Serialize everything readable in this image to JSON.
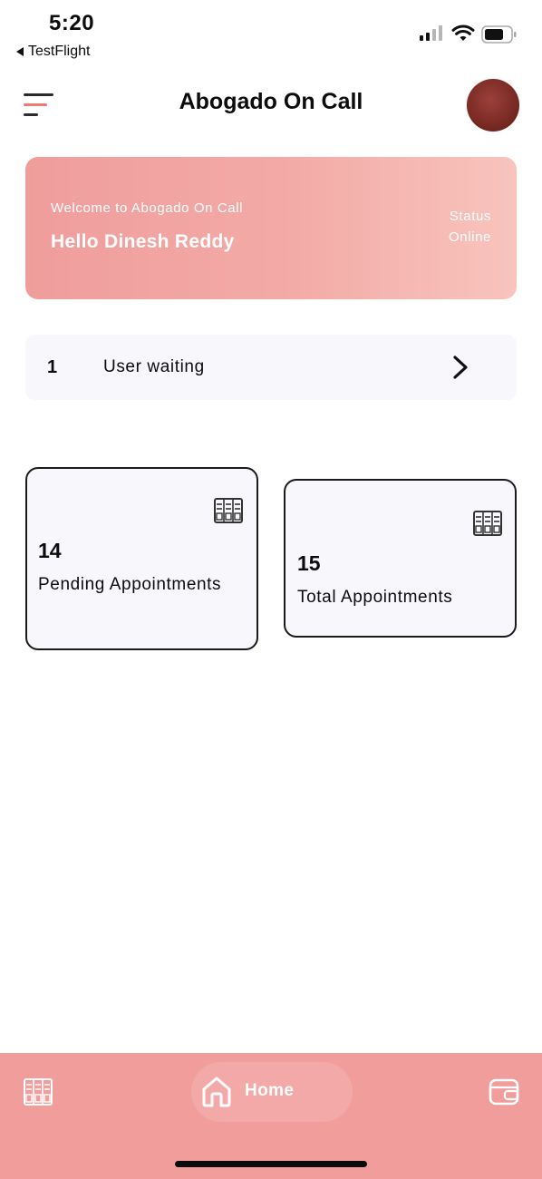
{
  "status_bar": {
    "time": "5:20",
    "back_app": "TestFlight"
  },
  "header": {
    "title": "Abogado On Call",
    "menu_icon": "menu-icon"
  },
  "welcome": {
    "subtitle": "Welcome to Abogado On Call",
    "greeting": "Hello Dinesh Reddy",
    "status_label": "Status",
    "status_value": "Online"
  },
  "waiting": {
    "count": "1",
    "label": "User waiting"
  },
  "cards": [
    {
      "number": "14",
      "label": "Pending Appointments"
    },
    {
      "number": "15",
      "label": "Total Appointments"
    }
  ],
  "bottom_nav": {
    "home_label": "Home",
    "left_icon": "calendar-icon",
    "right_icon": "wallet-icon"
  },
  "colors": {
    "accent": "#f19d9b",
    "card_gradient_start": "#ef9d9c",
    "card_gradient_end": "#f8c4bd",
    "menu_line_1": "#2b2b2b",
    "menu_line_2": "#ef7a75",
    "menu_line_3": "#2b2b2b"
  }
}
